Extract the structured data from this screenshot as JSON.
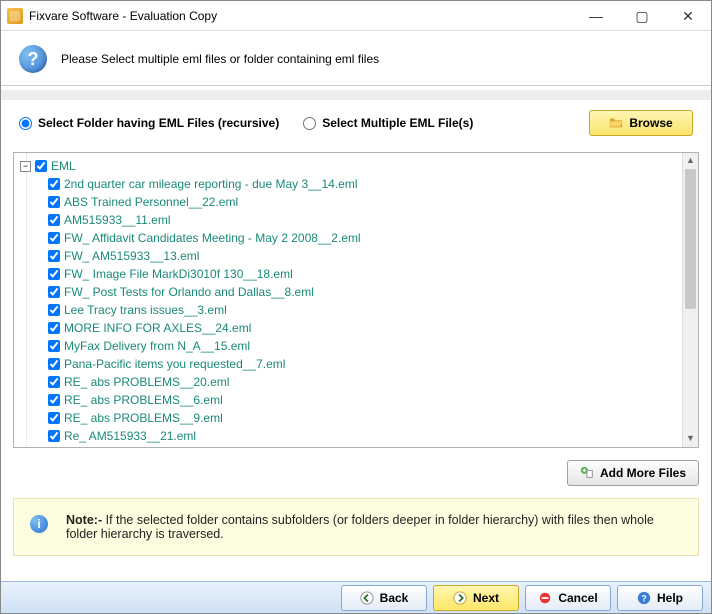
{
  "window": {
    "title": "Fixvare Software - Evaluation Copy"
  },
  "header": {
    "instruction": "Please Select multiple eml files or folder containing eml files"
  },
  "options": {
    "radio_folder_label": "Select Folder having EML Files (recursive)",
    "radio_files_label": "Select Multiple EML File(s)",
    "browse_label": "Browse",
    "selected": "folder"
  },
  "tree": {
    "root": "EML",
    "items": [
      "2nd quarter car mileage reporting - due May 3__14.eml",
      "ABS Trained Personnel__22.eml",
      "AM515933__11.eml",
      "FW_ Affidavit Candidates Meeting - May 2 2008__2.eml",
      "FW_ AM515933__13.eml",
      "FW_ Image File MarkDi3010f 130__18.eml",
      "FW_ Post Tests for Orlando and Dallas__8.eml",
      "Lee Tracy trans issues__3.eml",
      "MORE INFO FOR AXLES__24.eml",
      "MyFax Delivery from N_A__15.eml",
      "Pana-Pacific items you requested__7.eml",
      "RE_ abs PROBLEMS__20.eml",
      "RE_ abs PROBLEMS__6.eml",
      "RE_ abs PROBLEMS__9.eml",
      "Re_ AM515933__21.eml"
    ]
  },
  "add_more_label": "Add More Files",
  "note": {
    "prefix": "Note:-",
    "text": "If the selected folder contains subfolders (or folders deeper in folder hierarchy) with files then whole folder hierarchy is traversed."
  },
  "footer": {
    "back": "Back",
    "next": "Next",
    "cancel": "Cancel",
    "help": "Help"
  }
}
